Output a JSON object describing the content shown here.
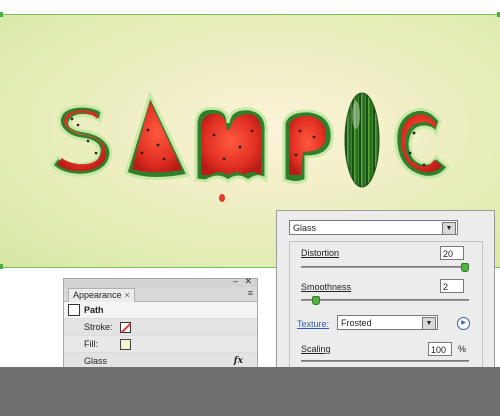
{
  "artwork": {
    "letters": [
      "S",
      "A",
      "M",
      "P",
      "I",
      "C"
    ],
    "colors": {
      "rind_outer": "#2f7f2c",
      "rind_light": "#c7e8a6",
      "flesh": "#e43a2a",
      "seed": "#2b1b16"
    }
  },
  "appearance_panel": {
    "tab_label": "Appearance",
    "tab_close": "×",
    "menu_icon": "≡",
    "rows": {
      "path": "Path",
      "stroke": "Stroke:",
      "fill": "Fill:",
      "effect": "Glass",
      "effect_icon": "fx"
    }
  },
  "glass_dialog": {
    "effect_select": "Glass",
    "distortion": {
      "label": "Distortion",
      "value": "20",
      "fraction": 1.0
    },
    "smoothness": {
      "label": "Smoothness",
      "value": "2",
      "fraction": 0.07
    },
    "texture": {
      "label": "Texture:",
      "value": "Frosted"
    },
    "scaling": {
      "label": "Scaling",
      "value": "100",
      "unit": "%"
    }
  }
}
